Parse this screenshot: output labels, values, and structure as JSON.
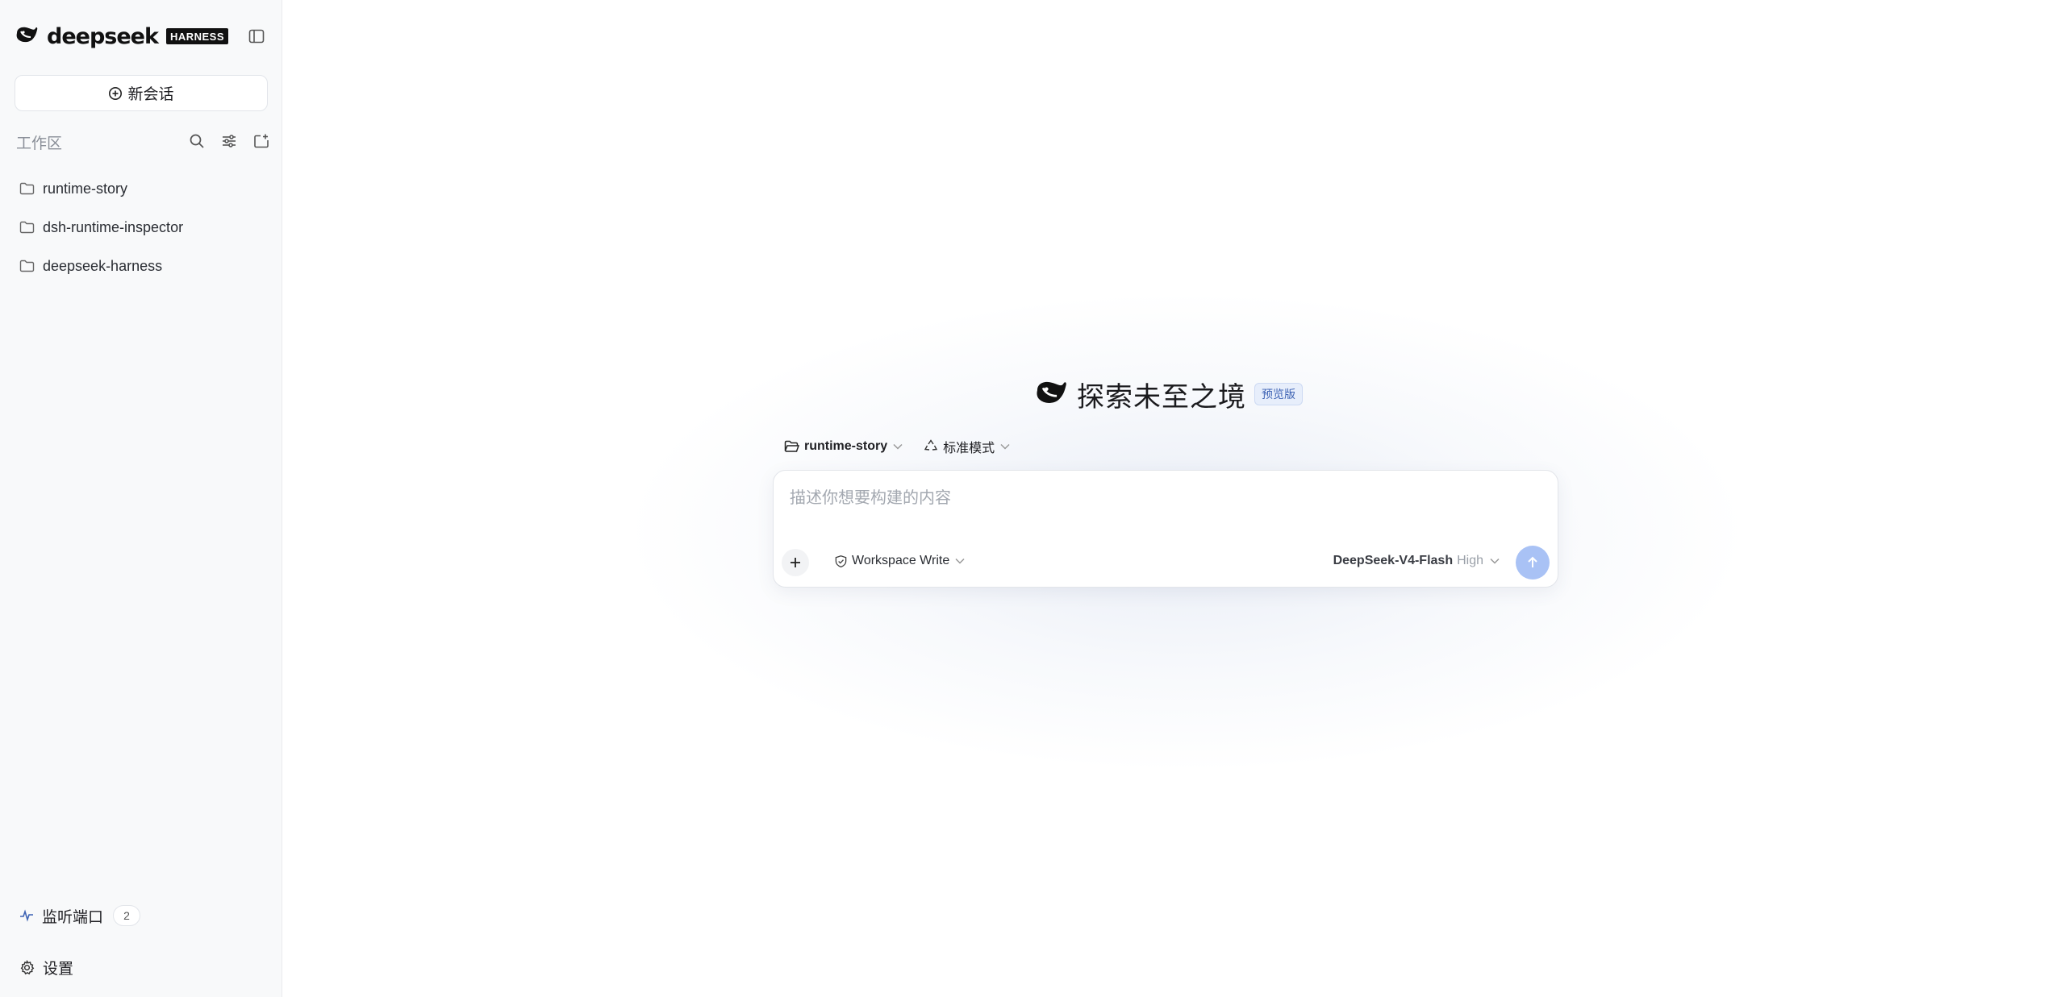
{
  "sidebar": {
    "brand_name": "deepseek",
    "brand_badge": "HARNESS",
    "new_chat_label": "新会话",
    "workspace_title": "工作区",
    "folders": [
      {
        "label": "runtime-story"
      },
      {
        "label": "dsh-runtime-inspector"
      },
      {
        "label": "deepseek-harness"
      }
    ],
    "monitor_label": "监听端口",
    "monitor_count": "2",
    "settings_label": "设置"
  },
  "main": {
    "hero_title": "探索未至之境",
    "hero_badge": "预览版",
    "workspace_selector": "runtime-story",
    "mode_selector": "标准模式",
    "input_placeholder": "描述你想要构建的内容",
    "permission_label": "Workspace Write",
    "model_name": "DeepSeek-V4-Flash",
    "model_level": "High"
  },
  "colors": {
    "sidebar_bg": "#f8f9fa",
    "send_button": "#a9c2f5",
    "badge_bg": "#e7eefb",
    "badge_text": "#3e63b4"
  },
  "icons": [
    "whale-logo-icon",
    "sidebar-toggle-icon",
    "plus-circle-icon",
    "search-icon",
    "sliders-icon",
    "folder-plus-icon",
    "folder-icon",
    "activity-icon",
    "gear-icon",
    "folder-open-icon",
    "recycle-icon",
    "chevron-down-icon",
    "plus-icon",
    "shield-icon",
    "arrow-up-icon"
  ]
}
